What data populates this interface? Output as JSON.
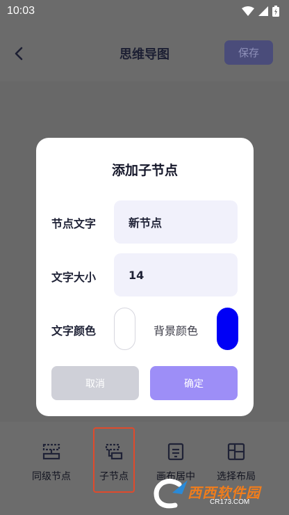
{
  "status_bar": {
    "time": "10:03"
  },
  "header": {
    "title": "思维导图",
    "save_label": "保存"
  },
  "dialog": {
    "title": "添加子节点",
    "node_text_label": "节点文字",
    "node_text_value": "新节点",
    "font_size_label": "文字大小",
    "font_size_value": "14",
    "text_color_label": "文字颜色",
    "text_color": "#ffffff",
    "bg_color_label": "背景颜色",
    "bg_color": "#0000f6",
    "cancel_label": "取消",
    "confirm_label": "确定"
  },
  "toolbar": {
    "items": [
      {
        "label": "同级节点",
        "icon": "sibling-node-icon"
      },
      {
        "label": "子节点",
        "icon": "child-node-icon"
      },
      {
        "label": "画布居中",
        "icon": "center-canvas-icon"
      },
      {
        "label": "选择布局",
        "icon": "layout-grid-icon"
      }
    ],
    "selected_index": 1
  },
  "colors": {
    "accent": "#9d8ef7",
    "highlight_border": "#e04a2c"
  }
}
